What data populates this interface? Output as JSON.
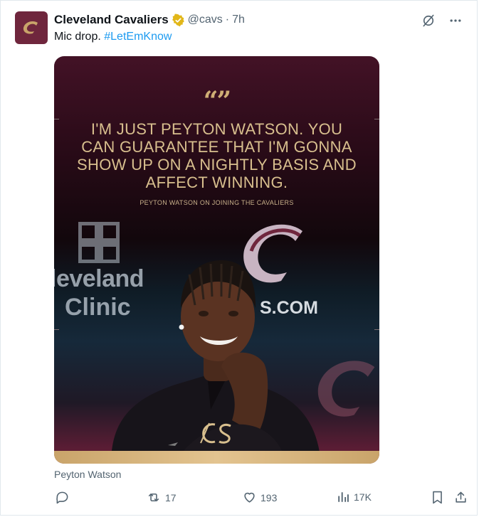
{
  "tweet": {
    "author_name": "Cleveland Cavaliers",
    "handle": "@cavs",
    "separator": "·",
    "time": "7h",
    "text_before": "Mic drop.",
    "hashtag": "#LetEmKnow",
    "icons": {
      "avatar": "cavaliers-c-logo",
      "verified": "gold-verified-badge",
      "grok": "grok-icon",
      "more": "more-horizontal-icon"
    }
  },
  "media": {
    "quote_marks": "“”",
    "quote_text": "I'M JUST PEYTON WATSON. YOU CAN GUARANTEE THAT I'M GONNA SHOW UP ON A NIGHTLY BASIS AND AFFECT WINNING.",
    "attribution": "PEYTON WATSON ON JOINING THE CAVALIERS",
    "backdrop_text": {
      "line1": "leveland",
      "line2": "Clinic",
      "domain": "S.COM"
    },
    "colors": {
      "wine": "#6f263d",
      "gold": "#d8bf8e",
      "navy": "#16293a"
    }
  },
  "caption": "Peyton Watson",
  "actions": {
    "reply": {
      "icon": "reply-icon",
      "count": ""
    },
    "repost": {
      "icon": "repost-icon",
      "count": "17"
    },
    "like": {
      "icon": "heart-icon",
      "count": "193"
    },
    "views": {
      "icon": "views-chart-icon",
      "count": "17K"
    },
    "bookmark": {
      "icon": "bookmark-icon"
    },
    "share": {
      "icon": "share-icon"
    }
  }
}
